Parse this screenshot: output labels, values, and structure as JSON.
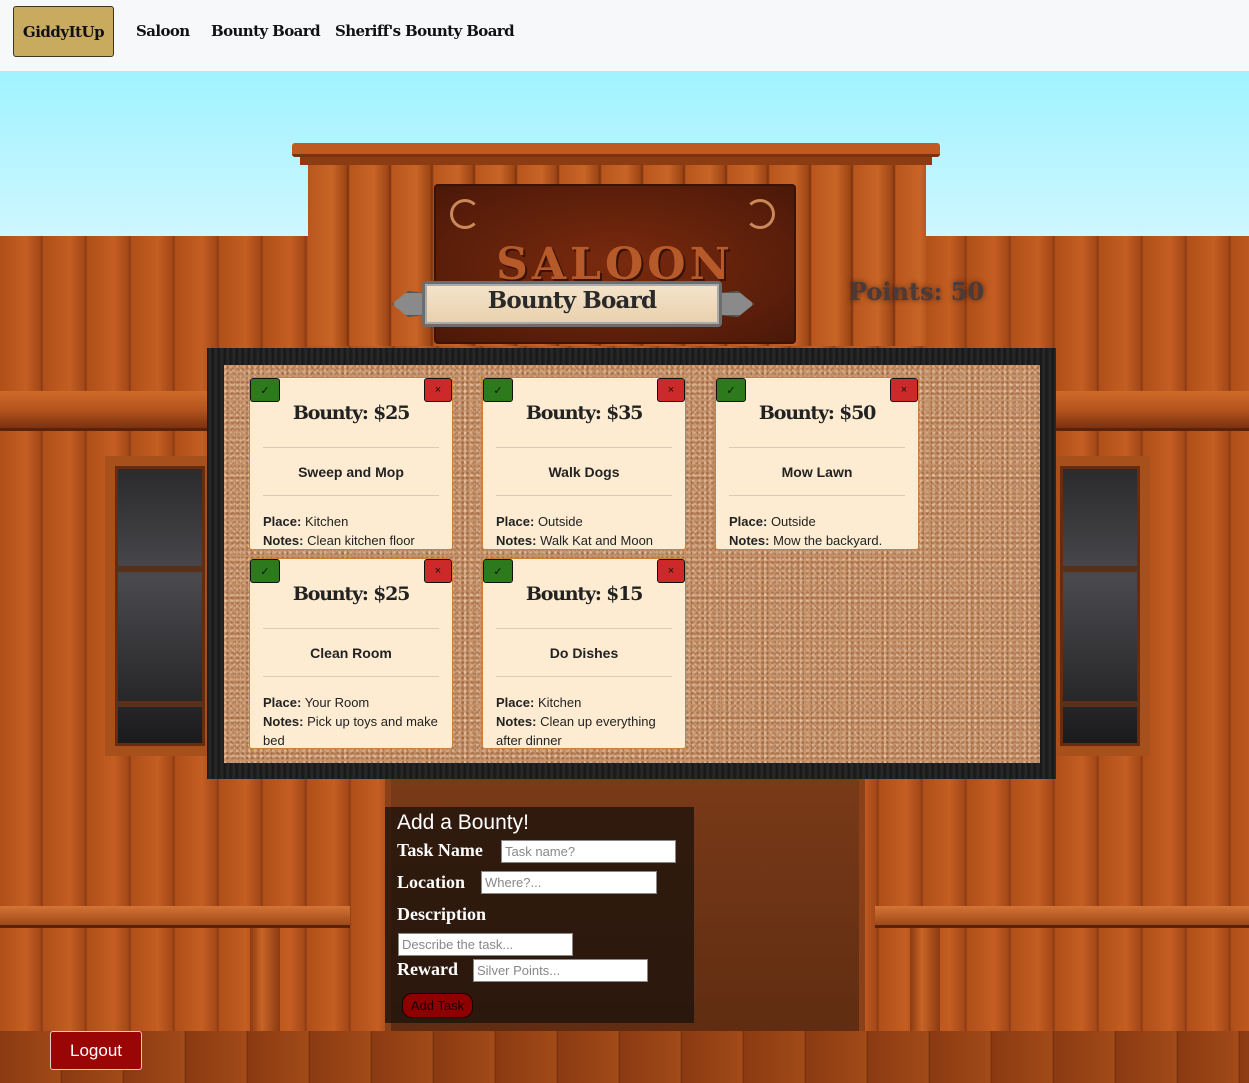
{
  "navbar": {
    "brand": "GiddyItUp",
    "links": [
      "Saloon",
      "Bounty Board",
      "Sheriff's Bounty Board"
    ]
  },
  "scene": {
    "sign_text": "SALOON"
  },
  "banner": {
    "title": "Bounty Board"
  },
  "points": "Points: 50",
  "card_actions": {
    "complete_icon": "✓",
    "delete_icon": "×"
  },
  "cards": [
    {
      "bounty": "Bounty: $25",
      "task": "Sweep and Mop",
      "place_label": "Place:",
      "place": "Kitchen",
      "notes_label": "Notes:",
      "notes": "Clean kitchen floor"
    },
    {
      "bounty": "Bounty: $35",
      "task": "Walk Dogs",
      "place_label": "Place:",
      "place": "Outside",
      "notes_label": "Notes:",
      "notes": "Walk Kat and Moon"
    },
    {
      "bounty": "Bounty: $50",
      "task": "Mow Lawn",
      "place_label": "Place:",
      "place": "Outside",
      "notes_label": "Notes:",
      "notes": "Mow the backyard."
    },
    {
      "bounty": "Bounty: $25",
      "task": "Clean Room",
      "place_label": "Place:",
      "place": "Your Room",
      "notes_label": "Notes:",
      "notes": "Pick up toys and make bed"
    },
    {
      "bounty": "Bounty: $15",
      "task": "Do Dishes",
      "place_label": "Place:",
      "place": "Kitchen",
      "notes_label": "Notes:",
      "notes": "Clean up everything after dinner"
    }
  ],
  "form": {
    "title": "Add a Bounty!",
    "task_name_label": "Task Name",
    "task_name_placeholder": "Task name?",
    "location_label": "Location",
    "location_placeholder": "Where?...",
    "description_label": "Description",
    "description_placeholder": "Describe the task...",
    "reward_label": "Reward",
    "reward_placeholder": "Silver Points...",
    "submit_label": "Add Task"
  },
  "logout_label": "Logout",
  "colors": {
    "brand_button": "#c9ab5f",
    "complete_button": "#2d7a1c",
    "delete_button": "#cc2a2a",
    "card_background": "#fdecd2",
    "logout_button": "#9a0505"
  }
}
